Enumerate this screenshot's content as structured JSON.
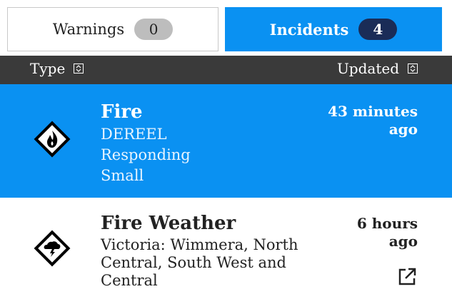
{
  "tabs": {
    "warnings": {
      "label": "Warnings",
      "count": "0"
    },
    "incidents": {
      "label": "Incidents",
      "count": "4"
    }
  },
  "header": {
    "type_label": "Type",
    "updated_label": "Updated"
  },
  "rows": [
    {
      "icon": "fire-icon",
      "title": "Fire",
      "lines": [
        "DEREEL",
        "Responding",
        "Small"
      ],
      "time": [
        "43 minutes",
        "ago"
      ],
      "selected": true
    },
    {
      "icon": "fire-weather-icon",
      "title": "Fire Weather",
      "description": "Victoria: Wimmera, North Central, South West and Central",
      "time": [
        "6 hours",
        "ago"
      ],
      "link_icon": "external-link-icon"
    }
  ],
  "colors": {
    "accent": "#0a91f2",
    "badge_dark": "#1a2c57",
    "header_bg": "#3a3a3a"
  }
}
